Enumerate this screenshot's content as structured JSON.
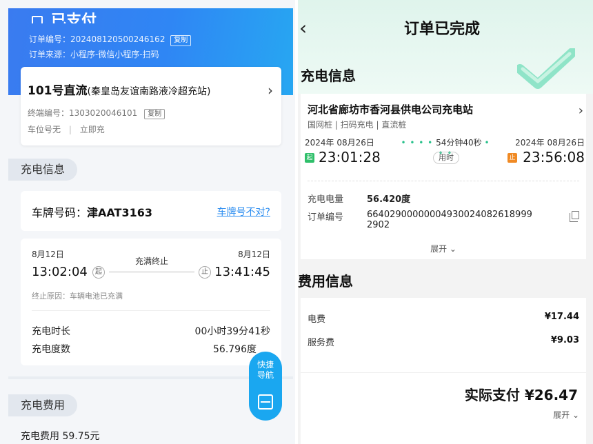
{
  "left": {
    "header": {
      "status_title": "已支付",
      "order_no_label": "订单编号：",
      "order_no": "20240812050024616",
      "order_no_tail": "2",
      "copy_label": "复制",
      "source_label": "订单来源：",
      "source": "小程序-微信小程序-扫码"
    },
    "station": {
      "name": "101号直流",
      "name_sub": "(秦皇岛友谊南路液冷超充站)",
      "terminal_label": "终端编号：",
      "terminal_no": "1303020046101",
      "copy_label": "复制",
      "spot": "车位号无",
      "divider": "|",
      "mode": "立即充"
    },
    "section_charge_info": "充电信息",
    "plate": {
      "label": "车牌号码：",
      "value": "津AAT3163",
      "wrong_link": "车牌号不对?"
    },
    "session": {
      "start_date": "8月12日",
      "start_time": "13:02:04",
      "start_mark": "起",
      "end_date": "8月12日",
      "end_time": "13:41:45",
      "end_mark": "止",
      "middle": "充满终止",
      "reason": "终止原因：车辆电池已充满",
      "duration_label": "充电时长",
      "duration_value": "00小时39分41秒",
      "energy_label": "充电度数",
      "energy_value": "56.796度"
    },
    "section_fee": "充电费用",
    "fee_peek": "充电费用 59.75元",
    "fab": {
      "line1": "快捷",
      "line2": "导航",
      "icon": "scan-icon"
    }
  },
  "right": {
    "title": "订单已完成",
    "back_icon": "back-chevron-icon",
    "section_charge_info": "充电信息",
    "station_name": "河北省廊坊市香河县供电公司充电站",
    "tags": "国网桩 | 扫码充电 | 直流桩",
    "start_date": "2024年 08月26日",
    "start_badge": "起",
    "start_time": "23:01:28",
    "duration": "54分钟40秒",
    "duration_dots_left": "• • • •",
    "duration_dots_right": "• • •",
    "use_label": "用时",
    "end_date": "2024年 08月26日",
    "end_badge": "止",
    "end_time": "23:56:08",
    "energy_label": "充电电量",
    "energy_value": "56.420度",
    "order_label": "订单编号",
    "order_line1": "66402900000004930024082618999",
    "order_line2": "2902",
    "expand": "展开 ⌄",
    "section_fee": "费用信息",
    "fees": [
      {
        "label": "电费",
        "amount": "¥17.44"
      },
      {
        "label": "服务费",
        "amount": "¥9.03"
      }
    ],
    "total_label": "实际支付 ¥26.47",
    "total_expand": "展开 ⌄",
    "colors": {
      "left_header": "#3a7bf0",
      "accent_link": "#2a8cf0",
      "start_badge": "#2fbf6a",
      "end_badge": "#f08a24",
      "right_header": "#dff4ec"
    }
  }
}
